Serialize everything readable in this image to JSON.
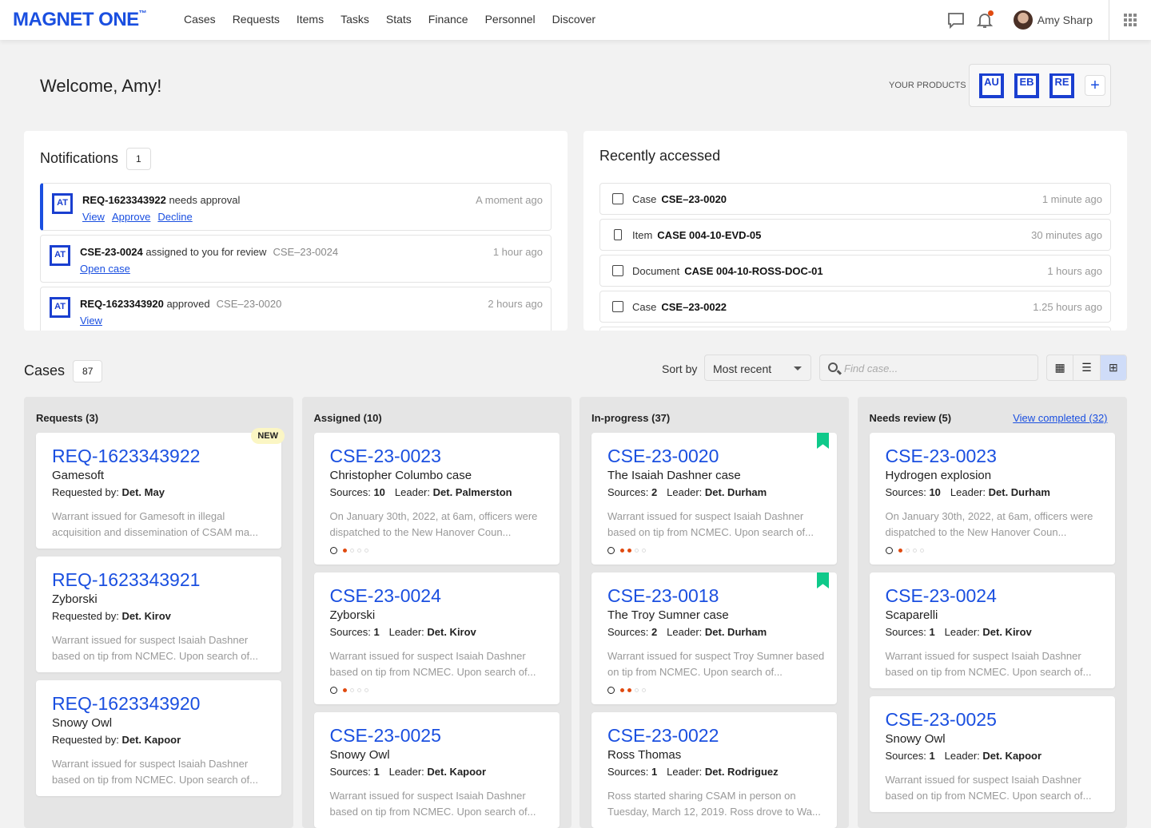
{
  "app": {
    "logo": "MAGNET ONE",
    "tm": "™"
  },
  "nav": [
    "Cases",
    "Requests",
    "Items",
    "Tasks",
    "Stats",
    "Finance",
    "Personnel",
    "Discover"
  ],
  "user": {
    "name": "Amy Sharp"
  },
  "welcome": "Welcome, Amy!",
  "products": {
    "label": "YOUR PRODUCTS",
    "items": [
      "AU",
      "EB",
      "RE"
    ],
    "add": "+"
  },
  "notifications": {
    "title": "Notifications",
    "count": "1",
    "items": [
      {
        "badge": "AT",
        "id": "REQ-1623343922",
        "text": "needs approval",
        "ref": "",
        "time": "A moment ago",
        "links": [
          "View",
          "Approve",
          "Decline"
        ],
        "active": true
      },
      {
        "badge": "AT",
        "id": "CSE-23-0024",
        "text": "assigned to you for review",
        "ref": "CSE–23-0024",
        "time": "1 hour ago",
        "links": [
          "Open case"
        ]
      },
      {
        "badge": "AT",
        "id": "REQ-1623343920",
        "text": "approved",
        "ref": "CSE–23-0020",
        "time": "2 hours ago",
        "links": [
          "View"
        ]
      }
    ]
  },
  "recent": {
    "title": "Recently accessed",
    "items": [
      {
        "icon": "briefcase-icon",
        "type": "Case",
        "id": "CSE–23-0020",
        "time": "1 minute ago"
      },
      {
        "icon": "phone-icon",
        "type": "Item",
        "id": "CASE 004-10-EVD-05",
        "time": "30 minutes ago"
      },
      {
        "icon": "document-icon",
        "type": "Document",
        "id": "CASE 004-10-ROSS-DOC-01",
        "time": "1 hours ago"
      },
      {
        "icon": "briefcase-icon",
        "type": "Case",
        "id": "CSE–23-0022",
        "time": "1.25 hours ago"
      }
    ]
  },
  "cases": {
    "title": "Cases",
    "count": "87",
    "sort_label": "Sort by",
    "sort_value": "Most recent",
    "search_placeholder": "Find case...",
    "columns": [
      {
        "title": "Requests (3)",
        "cards": [
          {
            "id": "REQ-1623343922",
            "name": "Gamesoft",
            "meta": [
              [
                "Requested by:",
                "Det. May"
              ]
            ],
            "desc": "Warrant issued for Gamesoft in illegal acquisition and dissemination of CSAM ma...",
            "badge": "NEW"
          },
          {
            "id": "REQ-1623343921",
            "name": "Zyborski",
            "meta": [
              [
                "Requested by:",
                "Det. Kirov"
              ]
            ],
            "desc": "Warrant issued for suspect Isaiah Dashner based on tip from NCMEC. Upon search of..."
          },
          {
            "id": "REQ-1623343920",
            "name": "Snowy Owl",
            "meta": [
              [
                "Requested by:",
                "Det. Kapoor"
              ]
            ],
            "desc": "Warrant issued for suspect Isaiah Dashner based on tip from NCMEC. Upon search of..."
          }
        ]
      },
      {
        "title": "Assigned (10)",
        "cards": [
          {
            "id": "CSE-23-0023",
            "name": "Christopher Columbo case",
            "meta": [
              [
                "Sources:",
                "10"
              ],
              [
                "Leader:",
                "Det. Palmerston"
              ]
            ],
            "desc": "On January 30th, 2022, at 6am, officers were dispatched to the New Hanover Coun...",
            "progress": 1
          },
          {
            "id": "CSE-23-0024",
            "name": "Zyborski",
            "meta": [
              [
                "Sources:",
                "1"
              ],
              [
                "Leader:",
                "Det. Kirov"
              ]
            ],
            "desc": "Warrant issued for suspect Isaiah Dashner based on tip from NCMEC. Upon search of...",
            "progress": 1
          },
          {
            "id": "CSE-23-0025",
            "name": "Snowy Owl",
            "meta": [
              [
                "Sources:",
                "1"
              ],
              [
                "Leader:",
                "Det. Kapoor"
              ]
            ],
            "desc": "Warrant issued for suspect Isaiah Dashner based on tip from NCMEC. Upon search of..."
          }
        ]
      },
      {
        "title": "In-progress (37)",
        "cards": [
          {
            "id": "CSE-23-0020",
            "name": "The Isaiah Dashner case",
            "meta": [
              [
                "Sources:",
                "2"
              ],
              [
                "Leader:",
                "Det. Durham"
              ]
            ],
            "desc": "Warrant issued for suspect Isaiah Dashner based on tip from NCMEC. Upon search of...",
            "progress": 2,
            "bookmarked": true
          },
          {
            "id": "CSE-23-0018",
            "name": "The Troy Sumner case",
            "meta": [
              [
                "Sources:",
                "2"
              ],
              [
                "Leader:",
                "Det. Durham"
              ]
            ],
            "desc": "Warrant issued for suspect Troy Sumner based on tip from NCMEC. Upon search of...",
            "progress": 2,
            "bookmarked": true
          },
          {
            "id": "CSE-23-0022",
            "name": "Ross Thomas",
            "meta": [
              [
                "Sources:",
                "1"
              ],
              [
                "Leader:",
                "Det. Rodriguez"
              ]
            ],
            "desc": "Ross started sharing CSAM in person on Tuesday, March 12, 2019. Ross drove to Wa..."
          }
        ]
      },
      {
        "title": "Needs review (5)",
        "link": "View completed (32)",
        "cards": [
          {
            "id": "CSE-23-0023",
            "name": "Hydrogen explosion",
            "meta": [
              [
                "Sources:",
                "10"
              ],
              [
                "Leader:",
                "Det. Durham"
              ]
            ],
            "desc": "On January 30th, 2022, at 6am, officers were dispatched to the New Hanover Coun...",
            "progress": 1
          },
          {
            "id": "CSE-23-0024",
            "name": "Scaparelli",
            "meta": [
              [
                "Sources:",
                "1"
              ],
              [
                "Leader:",
                "Det. Kirov"
              ]
            ],
            "desc": "Warrant issued for suspect Isaiah Dashner based on tip from NCMEC. Upon search of..."
          },
          {
            "id": "CSE-23-0025",
            "name": "Snowy Owl",
            "meta": [
              [
                "Sources:",
                "1"
              ],
              [
                "Leader:",
                "Det. Kapoor"
              ]
            ],
            "desc": "Warrant issued for suspect Isaiah Dashner based on tip from NCMEC. Upon search of..."
          }
        ]
      }
    ]
  },
  "colors": {
    "accent": "#1a4fe0",
    "progress": "#e04a10",
    "bookmark": "#0fc98a",
    "new_badge": "#fbf6c4"
  }
}
